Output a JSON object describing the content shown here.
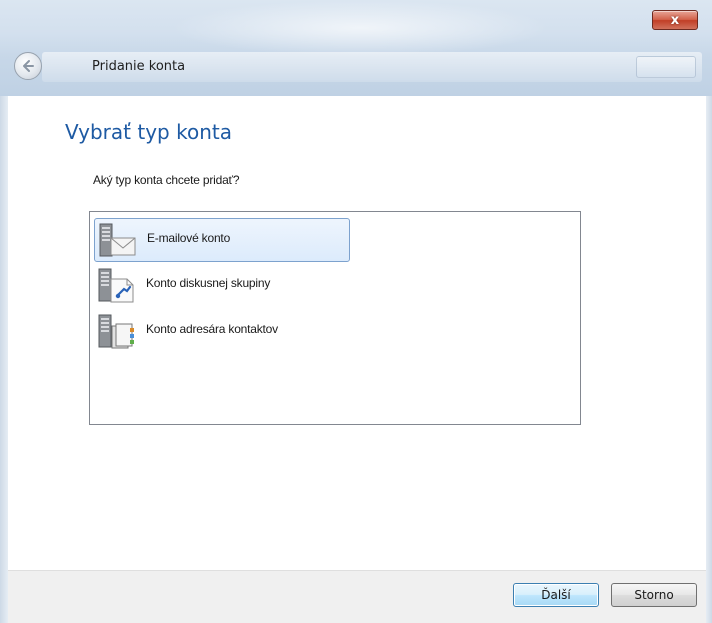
{
  "window": {
    "header_title": "Pridanie konta",
    "close_glyph": "x"
  },
  "page": {
    "title": "Vybrať typ konta",
    "question": "Aký typ konta chcete pridať?"
  },
  "account_types": [
    {
      "label": "E-mailové konto",
      "icon": "email-account-icon",
      "selected": true
    },
    {
      "label": "Konto diskusnej skupiny",
      "icon": "newsgroup-account-icon",
      "selected": false
    },
    {
      "label": "Konto adresára kontaktov",
      "icon": "directory-account-icon",
      "selected": false
    }
  ],
  "buttons": {
    "next": "Ďalší",
    "cancel": "Storno"
  },
  "colors": {
    "title_blue": "#1e5aa3",
    "selection_border": "#7da2ce",
    "close_red": "#c13e26"
  }
}
